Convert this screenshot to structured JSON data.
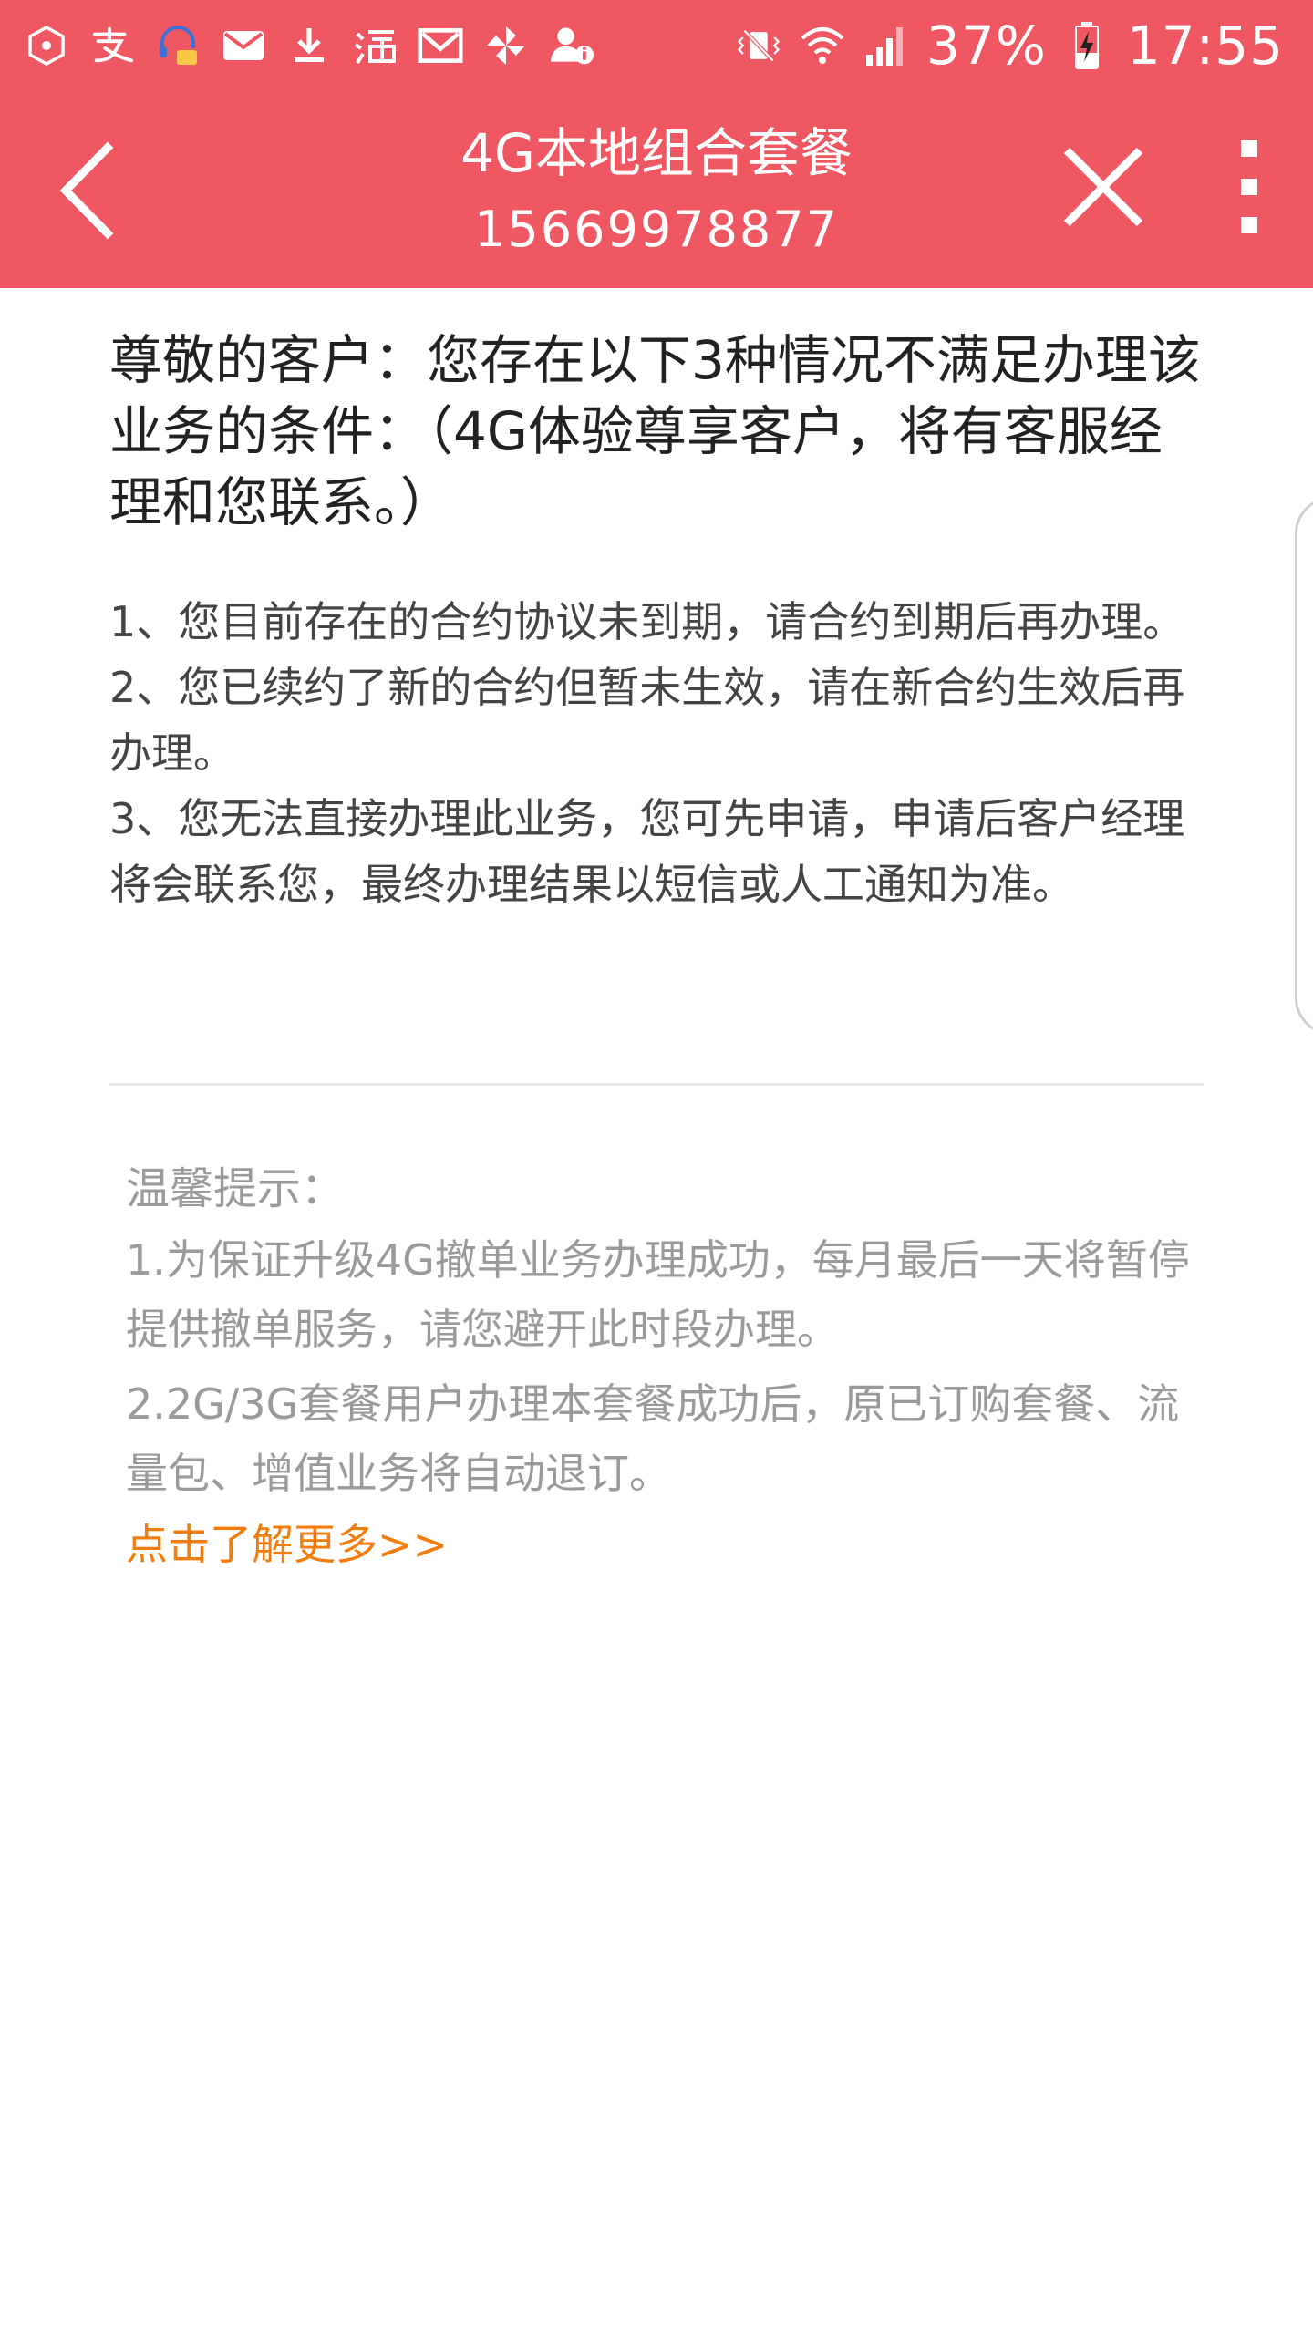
{
  "status_bar": {
    "left_icons": [
      "app-hex-icon",
      "alipay-icon",
      "headset-chat-icon",
      "mail-icon",
      "download-icon",
      "taobao-icon",
      "gmail-icon",
      "pinwheel-icon",
      "contact-info-icon"
    ],
    "right_icons": [
      "vibrate-mute-icon",
      "wifi-icon",
      "signal-icon",
      "battery-charging-icon"
    ],
    "battery": "37%",
    "time": "17:55"
  },
  "nav": {
    "title": "4G本地组合套餐",
    "phone": "15669978877",
    "back_icon": "back-chevron-icon",
    "close_icon": "close-icon",
    "more_icon": "more-vertical-icon",
    "bg_color": "#ef5862"
  },
  "notice": {
    "heading": "尊敬的客户：您存在以下3种情况不满足办理该业务的条件：（4G体验尊享客户，将有客服经理和您联系。）",
    "conditions": [
      "1、您目前存在的合约协议未到期，请合约到期后再办理。",
      "2、您已续约了新的合约但暂未生效，请在新合约生效后再办理。",
      "3、您无法直接办理此业务，您可先申请，申请后客户经理将会联系您，最终办理结果以短信或人工通知为准。"
    ]
  },
  "tips": {
    "title": "温馨提示：",
    "items": [
      "1.为保证升级4G撤单业务办理成功，每月最后一天将暂停提供撤单服务，请您避开此时段办理。",
      "2.2G/3G套餐用户办理本套餐成功后，原已订购套餐、流量包、增值业务将自动退订。"
    ],
    "more_link": "点击了解更多>>",
    "link_color": "#f27d0c"
  }
}
